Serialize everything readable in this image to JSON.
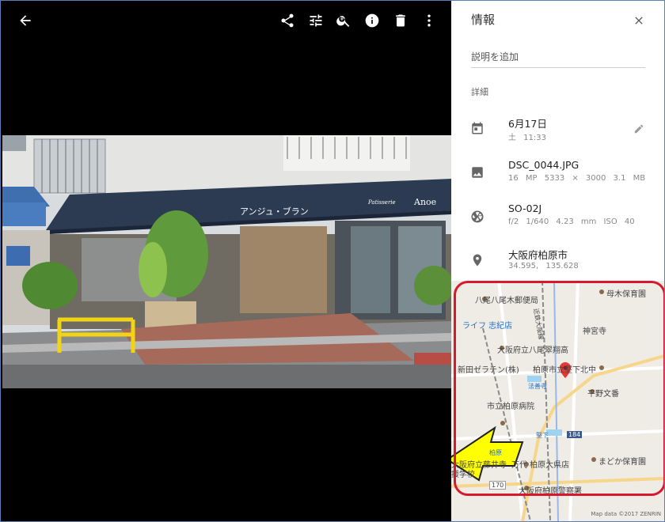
{
  "viewer": {
    "toolbar": {
      "back_icon": "arrow-left-icon",
      "share_icon": "share-icon",
      "edit_icon": "tune-icon",
      "zoom_icon": "zoom-icon",
      "info_icon": "info-icon",
      "delete_icon": "trash-icon",
      "more_icon": "more-vert-icon"
    },
    "photo": {
      "shop_sign": "アンジュ・ブラン",
      "shop_sign_right": "Anoe",
      "patisserie_text": "Patisserie"
    }
  },
  "panel": {
    "title": "情報",
    "description_placeholder": "説明を追加",
    "section_label": "詳細",
    "date": {
      "main": "6月17日",
      "sub": "土 11:33"
    },
    "file": {
      "name": "DSC_0044.JPG",
      "sub": "16 MP   5333 × 3000   3.1 MB"
    },
    "camera": {
      "model": "SO-02J",
      "sub": "f/2   1/640   4.23 mm   ISO 40"
    },
    "location": {
      "name": "大阪府柏原市",
      "coords": "34.595, 135.628"
    }
  },
  "map": {
    "labels": [
      "八尾八尾木郵便局",
      "母木保育園",
      "ライフ 志紀店",
      "神宮寺",
      "大阪府立八尾翠翔高",
      "新田ゼラチン(株)",
      "柏原市立堅下北中",
      "法善寺",
      "平野文番",
      "市立柏原病院",
      "堅下",
      "184",
      "柏原",
      "大阪府立藤井寺",
      "援学校",
      "万代 柏原大県店",
      "まどか保育園",
      "170",
      "大阪府柏原警察署",
      "近鉄大阪線"
    ],
    "attribution": "Map data ©2017 ZENRIN"
  },
  "colors": {
    "accent_red": "#d8182e",
    "arrow_yellow": "#ffff00",
    "marker_red": "#e53935"
  }
}
